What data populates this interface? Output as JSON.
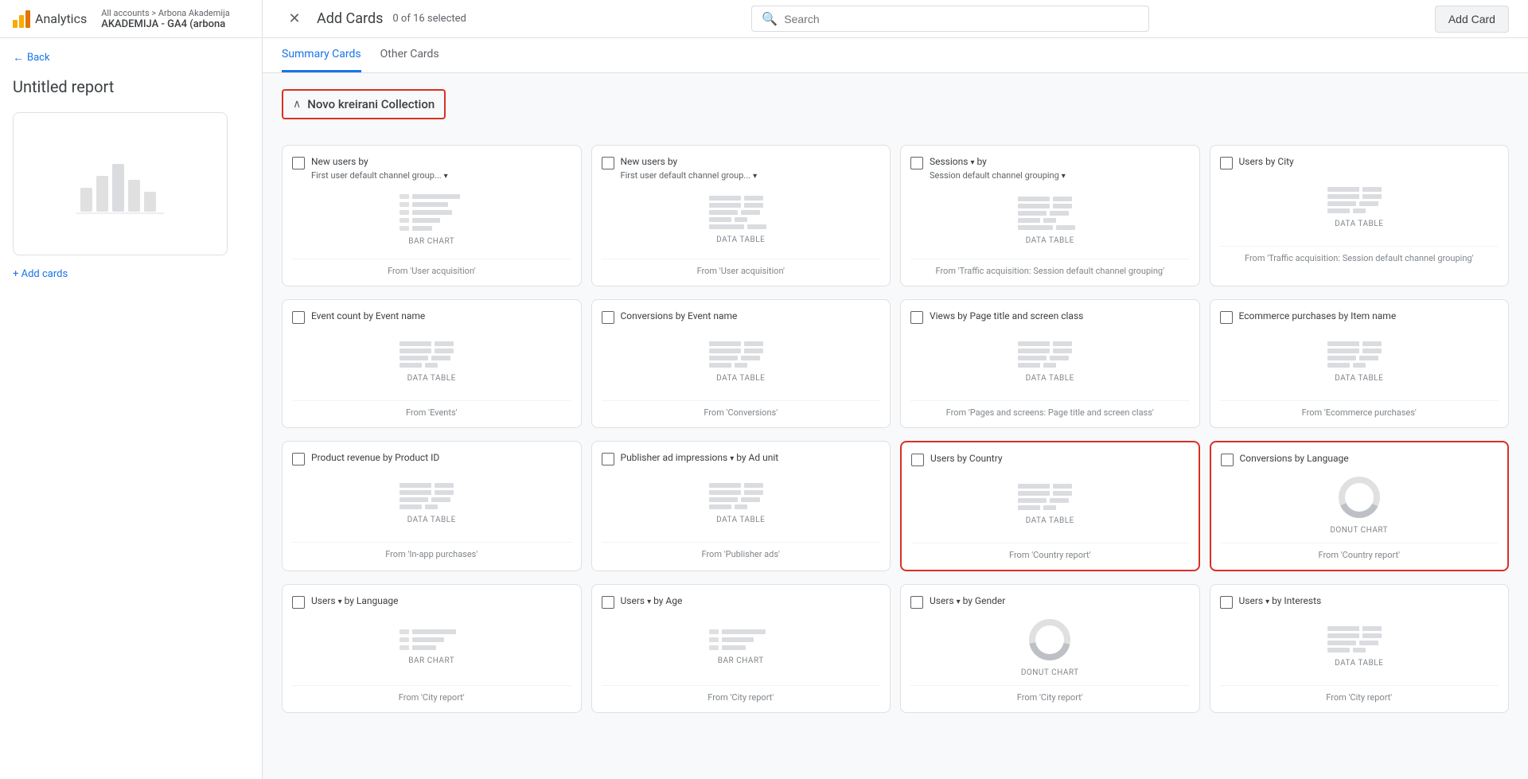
{
  "sidebar": {
    "analytics_label": "Analytics",
    "breadcrumb": "All accounts > Arbona Akademija",
    "account_name": "AKADEMIJA - GA4 (arbona",
    "back_label": "Back",
    "report_title": "Untitled report",
    "add_cards_label": "+ Add cards"
  },
  "header": {
    "title": "Add Cards",
    "selected_count": "0 of 16 selected",
    "search_placeholder": "Search",
    "add_card_btn": "Add Card"
  },
  "tabs": [
    {
      "id": "summary",
      "label": "Summary Cards",
      "active": true
    },
    {
      "id": "other",
      "label": "Other Cards",
      "active": false
    }
  ],
  "collection": {
    "name": "Novo kreirani Collection",
    "highlighted": true
  },
  "cards_row1": [
    {
      "id": "card-1",
      "title": "New users by",
      "subtitle": "First user default channel group...",
      "has_dropdown": true,
      "chart_type": "BAR CHART",
      "source": "From 'User acquisition'",
      "visual": "bar"
    },
    {
      "id": "card-2",
      "title": "New users by",
      "subtitle": "First user default channel group...",
      "has_dropdown": true,
      "chart_type": "DATA TABLE",
      "source": "From 'User acquisition'",
      "visual": "table"
    },
    {
      "id": "card-3",
      "title": "Sessions ▾ by",
      "subtitle": "Session default channel grouping ▾",
      "has_dropdown": false,
      "chart_type": "DATA TABLE",
      "source": "From 'Traffic acquisition: Session default channel grouping'",
      "visual": "table"
    },
    {
      "id": "card-4",
      "title": "Users by City",
      "subtitle": "",
      "has_dropdown": false,
      "chart_type": "DATA TABLE",
      "source": "From 'Traffic acquisition: Session default channel grouping'",
      "visual": "table"
    }
  ],
  "cards_row2": [
    {
      "id": "card-5",
      "title": "Event count by Event name",
      "subtitle": "",
      "has_dropdown": false,
      "chart_type": "DATA TABLE",
      "source": "From 'Events'",
      "visual": "table"
    },
    {
      "id": "card-6",
      "title": "Conversions by Event name",
      "subtitle": "",
      "has_dropdown": false,
      "chart_type": "DATA TABLE",
      "source": "From 'Conversions'",
      "visual": "table"
    },
    {
      "id": "card-7",
      "title": "Views by Page title and screen class",
      "subtitle": "",
      "has_dropdown": false,
      "chart_type": "DATA TABLE",
      "source": "From 'Pages and screens: Page title and screen class'",
      "visual": "table"
    },
    {
      "id": "card-8",
      "title": "Ecommerce purchases by Item name",
      "subtitle": "",
      "has_dropdown": false,
      "chart_type": "DATA TABLE",
      "source": "From 'Ecommerce purchases'",
      "visual": "table"
    }
  ],
  "cards_row3": [
    {
      "id": "card-9",
      "title": "Product revenue by Product ID",
      "subtitle": "",
      "has_dropdown": false,
      "chart_type": "DATA TABLE",
      "source": "From 'In-app purchases'",
      "visual": "table"
    },
    {
      "id": "card-10",
      "title": "Publisher ad impressions ▾ by Ad unit",
      "subtitle": "",
      "has_dropdown": false,
      "chart_type": "DATA TABLE",
      "source": "From 'Publisher ads'",
      "visual": "table"
    },
    {
      "id": "card-11",
      "title": "Users by Country",
      "subtitle": "",
      "has_dropdown": false,
      "chart_type": "DATA TABLE",
      "source": "From 'Country report'",
      "visual": "table",
      "highlighted": true
    },
    {
      "id": "card-12",
      "title": "Conversions by Language",
      "subtitle": "",
      "has_dropdown": false,
      "chart_type": "DONUT CHART",
      "source": "From 'Country report'",
      "visual": "donut",
      "highlighted": true
    }
  ],
  "cards_row4": [
    {
      "id": "card-13",
      "title": "Users ▾ by Language",
      "subtitle": "",
      "has_dropdown": false,
      "chart_type": "BAR CHART",
      "source": "From 'City report'",
      "visual": "bar"
    },
    {
      "id": "card-14",
      "title": "Users ▾ by Age",
      "subtitle": "",
      "has_dropdown": false,
      "chart_type": "BAR CHART",
      "source": "From 'City report'",
      "visual": "bar"
    },
    {
      "id": "card-15",
      "title": "Users ▾ by Gender",
      "subtitle": "",
      "has_dropdown": false,
      "chart_type": "DONUT CHART",
      "source": "From 'City report'",
      "visual": "donut"
    },
    {
      "id": "card-16",
      "title": "Users ▾ by Interests",
      "subtitle": "",
      "has_dropdown": false,
      "chart_type": "DATA TABLE",
      "source": "From 'City report'",
      "visual": "table"
    }
  ],
  "colors": {
    "primary_blue": "#1a73e8",
    "red_highlight": "#d93025",
    "text_primary": "#3c4043",
    "text_secondary": "#5f6368",
    "border": "#e0e0e0",
    "bg_light": "#f8f9fa"
  }
}
